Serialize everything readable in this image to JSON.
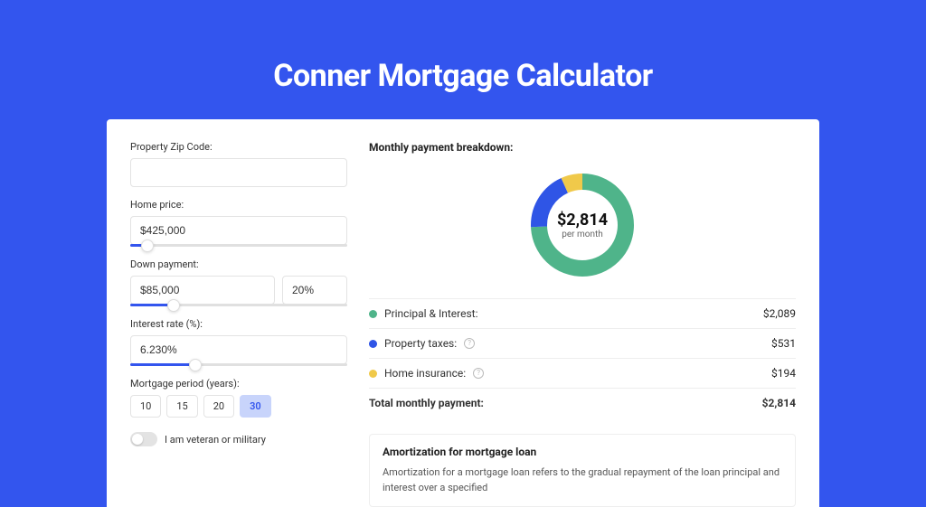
{
  "title": "Conner Mortgage Calculator",
  "form": {
    "zip_label": "Property Zip Code:",
    "zip_value": "",
    "home_price_label": "Home price:",
    "home_price_value": "$425,000",
    "home_price_slider_pct": 8,
    "down_payment_label": "Down payment:",
    "down_payment_value": "$85,000",
    "down_payment_pct_value": "20%",
    "down_payment_slider_pct": 20,
    "interest_label": "Interest rate (%):",
    "interest_value": "6.230%",
    "interest_slider_pct": 30,
    "period_label": "Mortgage period (years):",
    "periods": [
      "10",
      "15",
      "20",
      "30"
    ],
    "period_selected": "30",
    "veteran_label": "I am veteran or military"
  },
  "breakdown": {
    "title": "Monthly payment breakdown:",
    "center_value": "$2,814",
    "center_sub": "per month",
    "items": [
      {
        "label": "Principal & Interest:",
        "value": "$2,089",
        "color": "#4fb48a",
        "has_info": false
      },
      {
        "label": "Property taxes:",
        "value": "$531",
        "color": "#2f55e6",
        "has_info": true
      },
      {
        "label": "Home insurance:",
        "value": "$194",
        "color": "#f0c94a",
        "has_info": true
      }
    ],
    "total_label": "Total monthly payment:",
    "total_value": "$2,814"
  },
  "chart_data": {
    "type": "pie",
    "title": "Monthly payment breakdown",
    "series": [
      {
        "name": "Principal & Interest",
        "value": 2089,
        "color": "#4fb48a"
      },
      {
        "name": "Property taxes",
        "value": 531,
        "color": "#2f55e6"
      },
      {
        "name": "Home insurance",
        "value": 194,
        "color": "#f0c94a"
      }
    ],
    "total": 2814,
    "unit": "USD per month"
  },
  "amortization": {
    "title": "Amortization for mortgage loan",
    "text": "Amortization for a mortgage loan refers to the gradual repayment of the loan principal and interest over a specified"
  }
}
